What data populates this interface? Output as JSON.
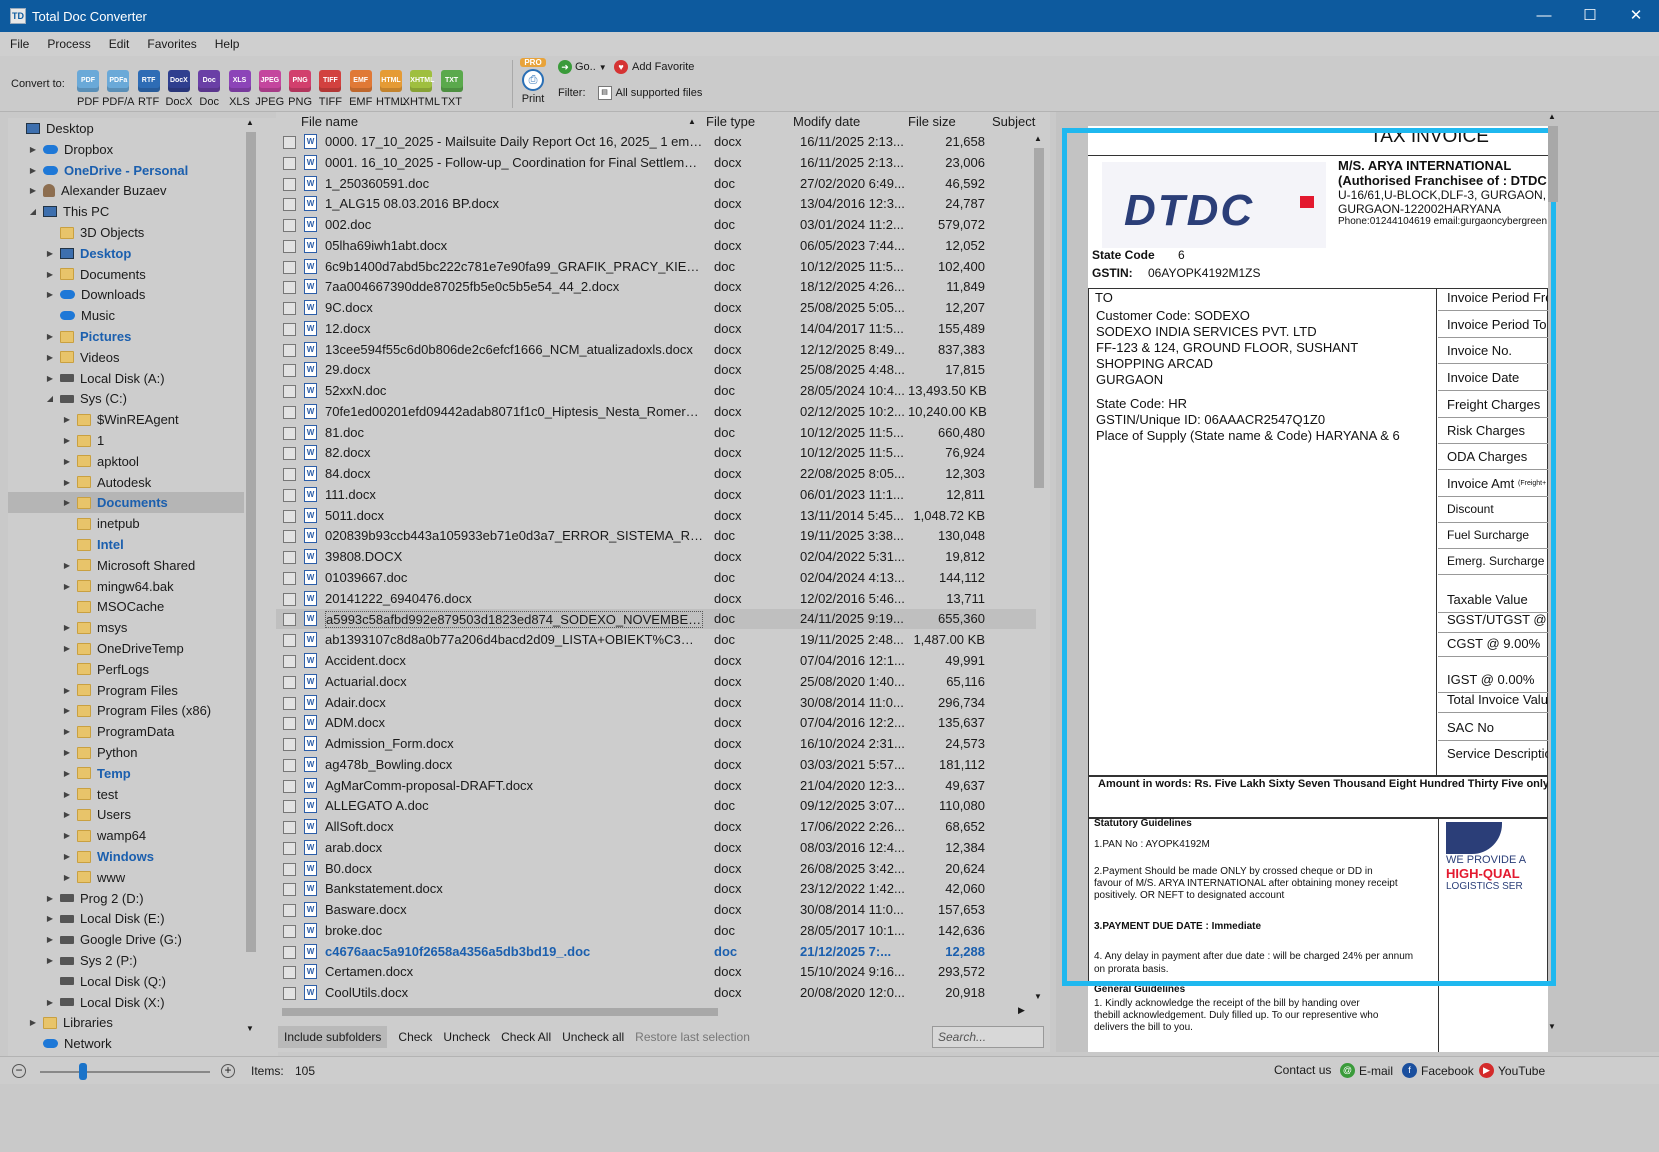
{
  "window": {
    "title": "Total Doc Converter",
    "app_icon": "TD"
  },
  "menu": [
    "File",
    "Process",
    "Edit",
    "Favorites",
    "Help"
  ],
  "toolbar": {
    "convert_label": "Convert to:",
    "formats": [
      {
        "icon": "PDF",
        "label": "PDF",
        "color": "#6aa9d8"
      },
      {
        "icon": "PDFa",
        "label": "PDF/A",
        "color": "#6aa9d8"
      },
      {
        "icon": "RTF",
        "label": "RTF",
        "color": "#2e6cb5"
      },
      {
        "icon": "DocX",
        "label": "DocX",
        "color": "#2f3f8f"
      },
      {
        "icon": "Doc",
        "label": "Doc",
        "color": "#6a3fa6"
      },
      {
        "icon": "XLS",
        "label": "XLS",
        "color": "#8c44b8"
      },
      {
        "icon": "JPEG",
        "label": "JPEG",
        "color": "#c4469e"
      },
      {
        "icon": "PNG",
        "label": "PNG",
        "color": "#d23f6d"
      },
      {
        "icon": "TIFF",
        "label": "TIFF",
        "color": "#d2413f"
      },
      {
        "icon": "EMF",
        "label": "EMF",
        "color": "#e07936"
      },
      {
        "icon": "HTML",
        "label": "HTML",
        "color": "#e59b35"
      },
      {
        "icon": "XHTML",
        "label": "XHTML",
        "color": "#9fbf3f"
      },
      {
        "icon": "TXT",
        "label": "TXT",
        "color": "#5aa94c"
      }
    ],
    "print_badge": "PRO",
    "print_label": "Print",
    "go_label": "Go..",
    "fav_label": "Add Favorite",
    "filter_label": "Filter:",
    "filter_value": "All supported files"
  },
  "tree": [
    {
      "label": "Desktop",
      "lvl": 0,
      "icon": "desktop-icon",
      "arrow": "",
      "style": ""
    },
    {
      "label": "Dropbox",
      "lvl": 1,
      "icon": "dropbox-icon",
      "arrow": "▶",
      "style": ""
    },
    {
      "label": "OneDrive - Personal",
      "lvl": 1,
      "icon": "cloud-icon",
      "arrow": "▶",
      "style": "blue"
    },
    {
      "label": "Alexander Buzaev",
      "lvl": 1,
      "icon": "user-icon",
      "arrow": "▶",
      "style": ""
    },
    {
      "label": "This PC",
      "lvl": 1,
      "icon": "pc-icon",
      "arrow": "◢",
      "style": ""
    },
    {
      "label": "3D Objects",
      "lvl": 2,
      "icon": "folder-icon",
      "arrow": "",
      "style": ""
    },
    {
      "label": "Desktop",
      "lvl": 2,
      "icon": "desktop-icon",
      "arrow": "▶",
      "style": "blue"
    },
    {
      "label": "Documents",
      "lvl": 2,
      "icon": "folder-icon",
      "arrow": "▶",
      "style": ""
    },
    {
      "label": "Downloads",
      "lvl": 2,
      "icon": "download-icon",
      "arrow": "▶",
      "style": ""
    },
    {
      "label": "Music",
      "lvl": 2,
      "icon": "music-icon",
      "arrow": "",
      "style": ""
    },
    {
      "label": "Pictures",
      "lvl": 2,
      "icon": "folder-icon",
      "arrow": "▶",
      "style": "blue"
    },
    {
      "label": "Videos",
      "lvl": 2,
      "icon": "folder-icon",
      "arrow": "▶",
      "style": ""
    },
    {
      "label": "Local Disk (A:)",
      "lvl": 2,
      "icon": "drive-icon",
      "arrow": "▶",
      "style": ""
    },
    {
      "label": "Sys (C:)",
      "lvl": 2,
      "icon": "drive-icon",
      "arrow": "◢",
      "style": ""
    },
    {
      "label": "$WinREAgent",
      "lvl": 3,
      "icon": "folder-icon",
      "arrow": "▶",
      "style": ""
    },
    {
      "label": "1",
      "lvl": 3,
      "icon": "folder-icon",
      "arrow": "▶",
      "style": ""
    },
    {
      "label": "apktool",
      "lvl": 3,
      "icon": "folder-icon",
      "arrow": "▶",
      "style": ""
    },
    {
      "label": "Autodesk",
      "lvl": 3,
      "icon": "folder-icon",
      "arrow": "▶",
      "style": ""
    },
    {
      "label": "Documents",
      "lvl": 3,
      "icon": "folder-icon",
      "arrow": "▶",
      "style": "blue",
      "sel": true
    },
    {
      "label": "inetpub",
      "lvl": 3,
      "icon": "folder-icon",
      "arrow": "",
      "style": ""
    },
    {
      "label": "Intel",
      "lvl": 3,
      "icon": "folder-icon",
      "arrow": "",
      "style": "blue"
    },
    {
      "label": "Microsoft Shared",
      "lvl": 3,
      "icon": "folder-icon",
      "arrow": "▶",
      "style": ""
    },
    {
      "label": "mingw64.bak",
      "lvl": 3,
      "icon": "folder-icon",
      "arrow": "▶",
      "style": ""
    },
    {
      "label": "MSOCache",
      "lvl": 3,
      "icon": "folder-icon",
      "arrow": "",
      "style": ""
    },
    {
      "label": "msys",
      "lvl": 3,
      "icon": "folder-icon",
      "arrow": "▶",
      "style": ""
    },
    {
      "label": "OneDriveTemp",
      "lvl": 3,
      "icon": "folder-icon",
      "arrow": "▶",
      "style": ""
    },
    {
      "label": "PerfLogs",
      "lvl": 3,
      "icon": "folder-icon",
      "arrow": "",
      "style": ""
    },
    {
      "label": "Program Files",
      "lvl": 3,
      "icon": "folder-icon",
      "arrow": "▶",
      "style": ""
    },
    {
      "label": "Program Files (x86)",
      "lvl": 3,
      "icon": "folder-icon",
      "arrow": "▶",
      "style": ""
    },
    {
      "label": "ProgramData",
      "lvl": 3,
      "icon": "folder-icon",
      "arrow": "▶",
      "style": ""
    },
    {
      "label": "Python",
      "lvl": 3,
      "icon": "folder-icon",
      "arrow": "▶",
      "style": ""
    },
    {
      "label": "Temp",
      "lvl": 3,
      "icon": "folder-icon",
      "arrow": "▶",
      "style": "blue"
    },
    {
      "label": "test",
      "lvl": 3,
      "icon": "folder-icon",
      "arrow": "▶",
      "style": ""
    },
    {
      "label": "Users",
      "lvl": 3,
      "icon": "folder-icon",
      "arrow": "▶",
      "style": ""
    },
    {
      "label": "wamp64",
      "lvl": 3,
      "icon": "folder-icon",
      "arrow": "▶",
      "style": ""
    },
    {
      "label": "Windows",
      "lvl": 3,
      "icon": "folder-icon",
      "arrow": "▶",
      "style": "blue"
    },
    {
      "label": "www",
      "lvl": 3,
      "icon": "folder-icon",
      "arrow": "▶",
      "style": ""
    },
    {
      "label": "Prog 2 (D:)",
      "lvl": 2,
      "icon": "drive-icon",
      "arrow": "▶",
      "style": ""
    },
    {
      "label": "Local Disk (E:)",
      "lvl": 2,
      "icon": "drive-icon",
      "arrow": "▶",
      "style": ""
    },
    {
      "label": "Google Drive (G:)",
      "lvl": 2,
      "icon": "drive-icon",
      "arrow": "▶",
      "style": ""
    },
    {
      "label": "Sys 2 (P:)",
      "lvl": 2,
      "icon": "drive-icon",
      "arrow": "▶",
      "style": ""
    },
    {
      "label": "Local Disk (Q:)",
      "lvl": 2,
      "icon": "drive-icon",
      "arrow": "",
      "style": ""
    },
    {
      "label": "Local Disk (X:)",
      "lvl": 2,
      "icon": "drive-icon",
      "arrow": "▶",
      "style": ""
    },
    {
      "label": "Libraries",
      "lvl": 1,
      "icon": "folder-icon",
      "arrow": "▶",
      "style": ""
    },
    {
      "label": "Network",
      "lvl": 1,
      "icon": "network-icon",
      "arrow": "",
      "style": ""
    }
  ],
  "file_list": {
    "headers": {
      "name": "File name",
      "type": "File type",
      "date": "Modify date",
      "size": "File size",
      "subject": "Subject"
    },
    "rows": [
      {
        "name": "0000. 17_10_2025 - Mailsuite Daily Report Oct 16, 2025_ 1 email s...",
        "type": "docx",
        "date": "16/11/2025 2:13...",
        "size": "21,658"
      },
      {
        "name": "0001. 16_10_2025 - Follow-up_ Coordination for Final Settlement ...",
        "type": "docx",
        "date": "16/11/2025 2:13...",
        "size": "23,006"
      },
      {
        "name": "1_250360591.doc",
        "type": "doc",
        "date": "27/02/2020 6:49...",
        "size": "46,592"
      },
      {
        "name": "1_ALG15 08.03.2016 BP.docx",
        "type": "docx",
        "date": "13/04/2016 12:3...",
        "size": "24,787"
      },
      {
        "name": "002.doc",
        "type": "doc",
        "date": "03/01/2024 11:2...",
        "size": "579,072"
      },
      {
        "name": "05lha69iwh1abt.docx",
        "type": "docx",
        "date": "06/05/2023 7:44...",
        "size": "12,052"
      },
      {
        "name": "6c9b1400d7abd5bc222c781e7e90fa99_GRAFIK_PRACY_KIEROWCW...",
        "type": "doc",
        "date": "10/12/2025 11:5...",
        "size": "102,400"
      },
      {
        "name": "7aa004667390dde87025fb5e0c5b5e54_44_2.docx",
        "type": "docx",
        "date": "18/12/2025 4:26...",
        "size": "11,849"
      },
      {
        "name": "9C.docx",
        "type": "docx",
        "date": "25/08/2025 5:05...",
        "size": "12,207"
      },
      {
        "name": "12.docx",
        "type": "docx",
        "date": "14/04/2017 11:5...",
        "size": "155,489"
      },
      {
        "name": "13cee594f55c6d0b806de2c6efcf1666_NCM_atualizadoxls.docx",
        "type": "docx",
        "date": "12/12/2025 8:49...",
        "size": "837,383"
      },
      {
        "name": "29.docx",
        "type": "docx",
        "date": "25/08/2025 4:48...",
        "size": "17,815"
      },
      {
        "name": "52xxN.doc",
        "type": "doc",
        "date": "28/05/2024 10:4...",
        "size": "13,493.50 KB"
      },
      {
        "name": "70fe1ed00201efd09442adab8071f1c0_Hiptesis_Nesta_Romero.docx",
        "type": "docx",
        "date": "02/12/2025 10:2...",
        "size": "10,240.00 KB"
      },
      {
        "name": "81.doc",
        "type": "doc",
        "date": "10/12/2025 11:5...",
        "size": "660,480"
      },
      {
        "name": "82.docx",
        "type": "docx",
        "date": "10/12/2025 11:5...",
        "size": "76,924"
      },
      {
        "name": "84.docx",
        "type": "docx",
        "date": "22/08/2025 8:05...",
        "size": "12,303"
      },
      {
        "name": "111.docx",
        "type": "docx",
        "date": "06/01/2023 11:1...",
        "size": "12,811"
      },
      {
        "name": "5011.docx",
        "type": "docx",
        "date": "13/11/2014 5:45...",
        "size": "1,048.72 KB"
      },
      {
        "name": "020839b93ccb443a105933eb71e0d3a7_ERROR_SISTEMA_RED_MA...",
        "type": "doc",
        "date": "19/11/2025 3:38...",
        "size": "130,048"
      },
      {
        "name": "39808.DOCX",
        "type": "docx",
        "date": "02/04/2022 5:31...",
        "size": "19,812"
      },
      {
        "name": "01039667.doc",
        "type": "doc",
        "date": "02/04/2024 4:13...",
        "size": "144,112"
      },
      {
        "name": "20141222_6940476.docx",
        "type": "docx",
        "date": "12/02/2016 5:46...",
        "size": "13,711"
      },
      {
        "name": "a5993c58afbd992e879503d1823ed874_SODEXO_NOVEMBER_INVOI...",
        "type": "doc",
        "date": "24/11/2025 9:19...",
        "size": "655,360",
        "hl": true
      },
      {
        "name": "ab1393107c8d8a0b77a206d4bacd2d09_LISTA+OBIEKT%C3%93W+...",
        "type": "doc",
        "date": "19/11/2025 2:48...",
        "size": "1,487.00 KB"
      },
      {
        "name": "Accident.docx",
        "type": "docx",
        "date": "07/04/2016 12:1...",
        "size": "49,991"
      },
      {
        "name": "Actuarial.docx",
        "type": "docx",
        "date": "25/08/2020 1:40...",
        "size": "65,116"
      },
      {
        "name": "Adair.docx",
        "type": "docx",
        "date": "30/08/2014 11:0...",
        "size": "296,734"
      },
      {
        "name": "ADM.docx",
        "type": "docx",
        "date": "07/04/2016 12:2...",
        "size": "135,637"
      },
      {
        "name": "Admission_Form.docx",
        "type": "docx",
        "date": "16/10/2024 2:31...",
        "size": "24,573"
      },
      {
        "name": "ag478b_Bowling.docx",
        "type": "docx",
        "date": "03/03/2021 5:57...",
        "size": "181,112"
      },
      {
        "name": "AgMarComm-proposal-DRAFT.docx",
        "type": "docx",
        "date": "21/04/2020 12:3...",
        "size": "49,637"
      },
      {
        "name": "ALLEGATO A.doc",
        "type": "doc",
        "date": "09/12/2025 3:07...",
        "size": "110,080"
      },
      {
        "name": "AllSoft.docx",
        "type": "docx",
        "date": "17/06/2022 2:26...",
        "size": "68,652"
      },
      {
        "name": "arab.docx",
        "type": "docx",
        "date": "08/03/2016 12:4...",
        "size": "12,384"
      },
      {
        "name": "B0.docx",
        "type": "docx",
        "date": "26/08/2025 3:42...",
        "size": "20,624"
      },
      {
        "name": "Bankstatement.docx",
        "type": "docx",
        "date": "23/12/2022 1:42...",
        "size": "42,060"
      },
      {
        "name": "Basware.docx",
        "type": "docx",
        "date": "30/08/2014 11:0...",
        "size": "157,653"
      },
      {
        "name": "broke.doc",
        "type": "doc",
        "date": "28/05/2017 10:1...",
        "size": "142,636"
      },
      {
        "name": "c4676aac5a910f2658a4356a5db3bd19_.doc",
        "type": "doc",
        "date": "21/12/2025 7:...",
        "size": "12,288",
        "bold": true
      },
      {
        "name": "Certamen.docx",
        "type": "docx",
        "date": "15/10/2024 9:16...",
        "size": "293,572"
      },
      {
        "name": "CoolUtils.docx",
        "type": "docx",
        "date": "20/08/2020 12:0...",
        "size": "20,918"
      }
    ]
  },
  "bottom_buttons": {
    "include": "Include subfolders",
    "check": "Check",
    "uncheck": "Uncheck",
    "check_all": "Check All",
    "uncheck_all": "Uncheck all",
    "restore": "Restore last selection",
    "search_placeholder": "Search..."
  },
  "preview": {
    "title": "TAX INVOICE",
    "logo_text": "DTDC",
    "company": "M/S. ARYA INTERNATIONAL",
    "franchise": "(Authorised Franchisee of : DTDC EX",
    "addr1": "U-16/61,U-BLOCK,DLF-3, GURGAON, H",
    "addr2": "GURGAON-122002HARYANA",
    "phone": "Phone:01244104619 email:gurgaoncybergreen",
    "state_code_label": "State Code",
    "state_code_val": "6",
    "gstin_label": "GSTIN:",
    "gstin_val": "06AYOPK4192M1ZS",
    "to": "TO",
    "cust_lines": [
      "Customer Code: SODEXO",
      "SODEXO INDIA SERVICES PVT. LTD",
      "FF-123 & 124, GROUND FLOOR, SUSHANT",
      "SHOPPING ARCAD",
      "GURGAON"
    ],
    "cust_lines2": [
      "State Code: HR",
      "GSTIN/Unique ID: 06AAACR2547Q1Z0",
      "Place of Supply (State name & Code) HARYANA  & 6"
    ],
    "right_col": [
      "Invoice Period Fro",
      "Invoice Period To",
      "Invoice No.",
      "Invoice Date",
      "Freight Charges",
      "Risk Charges",
      "ODA Charges",
      "Invoice Amt",
      "Discount",
      "Fuel Surcharge",
      "Emerg. Surcharge",
      "Taxable Value",
      "SGST/UTGST @",
      "CGST @ 9.00%",
      "IGST @ 0.00%",
      "Total Invoice Valu",
      "SAC No",
      "Service Descriptio"
    ],
    "invoice_amt_note": "(Freight+",
    "amount_words": "Amount in words: Rs. Five Lakh Sixty Seven Thousand Eight Hundred Thirty Five only",
    "stat_head": "Statutory Guidelines",
    "stat1": "1.PAN No : AYOPK4192M",
    "stat2a": "2.Payment Should be made ONLY by crossed cheque or DD in",
    "stat2b": "favour of M/S. ARYA INTERNATIONAL after obtaining money receipt",
    "stat2c": "positively. OR NEFT to designated account",
    "stat3": "3.PAYMENT DUE DATE : Immediate",
    "stat4a": "4. Any delay in payment after due date : will be charged 24% per annum",
    "stat4b": "on prorata basis.",
    "gen_head": "General Guidelines",
    "gen1a": "1.          Kindly acknowledge the receipt of the bill by handing over",
    "gen1b": "thebill acknowledgement. Duly filled up. To our representive who",
    "gen1c": "delivers the bill to you.",
    "ad1": "WE PROVIDE A",
    "ad2": "HIGH-QUAL",
    "ad3": "LOGISTICS SER"
  },
  "status": {
    "items_label": "Items:",
    "items_count": "105",
    "contact": "Contact us",
    "email": "E-mail",
    "facebook": "Facebook",
    "youtube": "YouTube",
    "zoom_level": 0.25
  },
  "colors": {
    "accent": "#1fb8ef",
    "titlebar": "#0d5a9e",
    "link": "#1b5fae"
  }
}
